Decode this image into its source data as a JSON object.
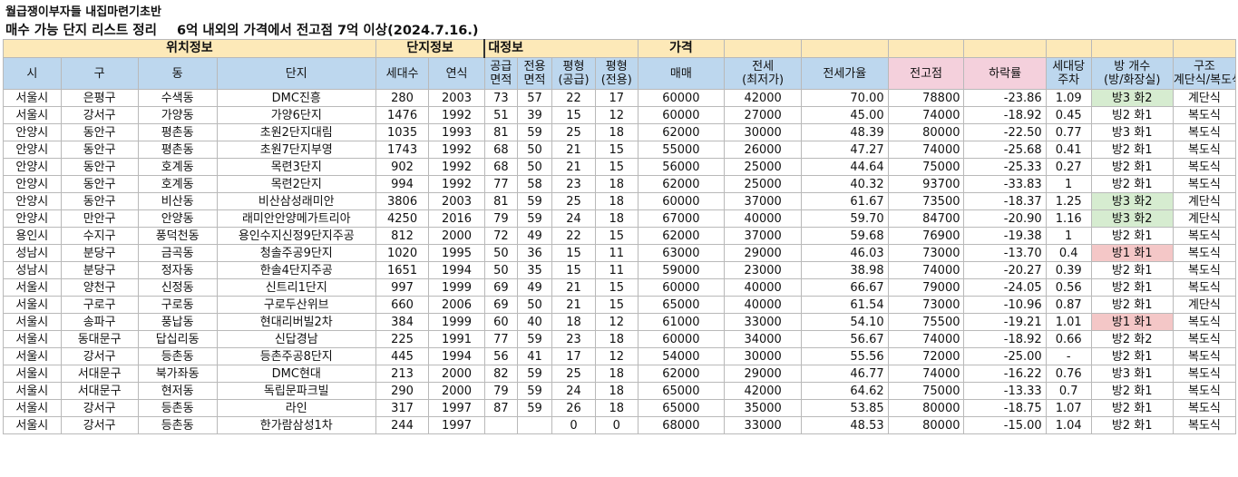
{
  "title": "월급쟁이부자들 내집마련기초반",
  "subtitle_main": "매수 가능 단지 리스트 정리",
  "subtitle_sub": "6억 내외의 가격에서 전고점 7억 이상(2024.7.16.)",
  "groups": {
    "location": "위치정보",
    "complex": "단지정보",
    "unit": "대정보",
    "price": "가격"
  },
  "columns": [
    "시",
    "구",
    "동",
    "단지",
    "세대수",
    "연식",
    "공급\n면적",
    "전용\n면적",
    "평형\n(공급)",
    "평형\n(전용)",
    "매매",
    "전세\n(최저가)",
    "전세가율",
    "전고점",
    "하락률",
    "세대당\n주차",
    "방 개수\n(방/화장실)",
    "구조\n계단식/복도식"
  ],
  "rows": [
    [
      "서울시",
      "은평구",
      "수색동",
      "DMC진흥",
      "280",
      "2003",
      "73",
      "57",
      "22",
      "17",
      "60000",
      "42000",
      "70.00",
      "78800",
      "-23.86",
      "1.09",
      "방3 화2",
      "계단식"
    ],
    [
      "서울시",
      "강서구",
      "가양동",
      "가양6단지",
      "1476",
      "1992",
      "51",
      "39",
      "15",
      "12",
      "60000",
      "27000",
      "45.00",
      "74000",
      "-18.92",
      "0.45",
      "빙2 화1",
      "복도식"
    ],
    [
      "안양시",
      "동안구",
      "평촌동",
      "초원2단지대림",
      "1035",
      "1993",
      "81",
      "59",
      "25",
      "18",
      "62000",
      "30000",
      "48.39",
      "80000",
      "-22.50",
      "0.77",
      "방3 화1",
      "복도식"
    ],
    [
      "안양시",
      "동안구",
      "평촌동",
      "초원7단지부영",
      "1743",
      "1992",
      "68",
      "50",
      "21",
      "15",
      "55000",
      "26000",
      "47.27",
      "74000",
      "-25.68",
      "0.41",
      "방2 화1",
      "복도식"
    ],
    [
      "안양시",
      "동안구",
      "호계동",
      "목련3단지",
      "902",
      "1992",
      "68",
      "50",
      "21",
      "15",
      "56000",
      "25000",
      "44.64",
      "75000",
      "-25.33",
      "0.27",
      "방2 화1",
      "복도식"
    ],
    [
      "안양시",
      "동안구",
      "호계동",
      "목련2단지",
      "994",
      "1992",
      "77",
      "58",
      "23",
      "18",
      "62000",
      "25000",
      "40.32",
      "93700",
      "-33.83",
      "1",
      "방2 화1",
      "복도식"
    ],
    [
      "안양시",
      "동안구",
      "비산동",
      "비산삼성래미안",
      "3806",
      "2003",
      "81",
      "59",
      "25",
      "18",
      "60000",
      "37000",
      "61.67",
      "73500",
      "-18.37",
      "1.25",
      "방3 화2",
      "계단식"
    ],
    [
      "안양시",
      "만안구",
      "안양동",
      "래미안안양메가트리아",
      "4250",
      "2016",
      "79",
      "59",
      "24",
      "18",
      "67000",
      "40000",
      "59.70",
      "84700",
      "-20.90",
      "1.16",
      "방3 화2",
      "계단식"
    ],
    [
      "용인시",
      "수지구",
      "풍덕천동",
      "용인수지신정9단지주공",
      "812",
      "2000",
      "72",
      "49",
      "22",
      "15",
      "62000",
      "37000",
      "59.68",
      "76900",
      "-19.38",
      "1",
      "방2 화1",
      "복도식"
    ],
    [
      "성남시",
      "분당구",
      "금곡동",
      "청솔주공9단지",
      "1020",
      "1995",
      "50",
      "36",
      "15",
      "11",
      "63000",
      "29000",
      "46.03",
      "73000",
      "-13.70",
      "0.4",
      "방1 화1",
      "복도식"
    ],
    [
      "성남시",
      "분당구",
      "정자동",
      "한솔4단지주공",
      "1651",
      "1994",
      "50",
      "35",
      "15",
      "11",
      "59000",
      "23000",
      "38.98",
      "74000",
      "-20.27",
      "0.39",
      "방2 화1",
      "복도식"
    ],
    [
      "서울시",
      "양천구",
      "신정동",
      "신트리1단지",
      "997",
      "1999",
      "69",
      "49",
      "21",
      "15",
      "60000",
      "40000",
      "66.67",
      "79000",
      "-24.05",
      "0.56",
      "방2 화1",
      "복도식"
    ],
    [
      "서울시",
      "구로구",
      "구로동",
      "구로두산위브",
      "660",
      "2006",
      "69",
      "50",
      "21",
      "15",
      "65000",
      "40000",
      "61.54",
      "73000",
      "-10.96",
      "0.87",
      "방2 화1",
      "계단식"
    ],
    [
      "서울시",
      "송파구",
      "풍납동",
      "현대리버빌2차",
      "384",
      "1999",
      "60",
      "40",
      "18",
      "12",
      "61000",
      "33000",
      "54.10",
      "75500",
      "-19.21",
      "1.01",
      "방1 화1",
      "복도식"
    ],
    [
      "서울시",
      "동대문구",
      "답십리동",
      "신답경남",
      "225",
      "1991",
      "77",
      "59",
      "23",
      "18",
      "60000",
      "34000",
      "56.67",
      "74000",
      "-18.92",
      "0.66",
      "방2 화2",
      "복도식"
    ],
    [
      "서울시",
      "강서구",
      "등촌동",
      "등촌주공8단지",
      "445",
      "1994",
      "56",
      "41",
      "17",
      "12",
      "54000",
      "30000",
      "55.56",
      "72000",
      "-25.00",
      "-",
      "방2 화1",
      "복도식"
    ],
    [
      "서울시",
      "서대문구",
      "북가좌동",
      "DMC현대",
      "213",
      "2000",
      "82",
      "59",
      "25",
      "18",
      "62000",
      "29000",
      "46.77",
      "74000",
      "-16.22",
      "0.76",
      "방3 화1",
      "복도식"
    ],
    [
      "서울시",
      "서대문구",
      "현저동",
      "독립문파크빌",
      "290",
      "2000",
      "79",
      "59",
      "24",
      "18",
      "65000",
      "42000",
      "64.62",
      "75000",
      "-13.33",
      "0.7",
      "방2 화1",
      "복도식"
    ],
    [
      "서울시",
      "강서구",
      "등촌동",
      "라인",
      "317",
      "1997",
      "87",
      "59",
      "26",
      "18",
      "65000",
      "35000",
      "53.85",
      "80000",
      "-18.75",
      "1.07",
      "방2 화1",
      "복도식"
    ],
    [
      "서울시",
      "강서구",
      "등촌동",
      "한가람삼성1차",
      "244",
      "1997",
      "",
      "",
      "0",
      "0",
      "68000",
      "33000",
      "48.53",
      "80000",
      "-15.00",
      "1.04",
      "방2 화1",
      "복도식"
    ]
  ],
  "room_highlights": {
    "0": "#d6ecd0",
    "6": "#d6ecd0",
    "7": "#d6ecd0",
    "9": "#f4c7c7",
    "13": "#f4c7c7"
  },
  "colors": {
    "group_header_bg": "#fde9b8",
    "column_header_bg": "#bdd7ee",
    "pink_header_bg": "#f4d0dc",
    "grid_line": "#b9b9b9"
  }
}
